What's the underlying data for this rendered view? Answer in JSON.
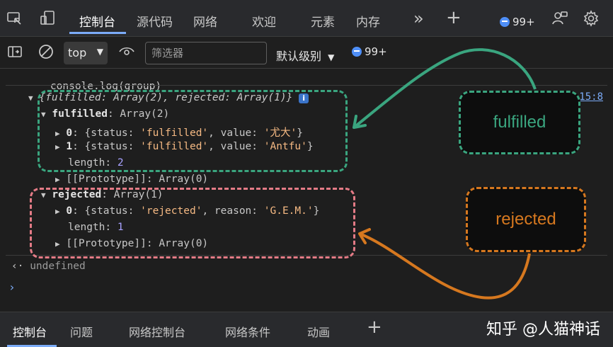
{
  "tabs": {
    "items": [
      {
        "label": "控制台"
      },
      {
        "label": "源代码"
      },
      {
        "label": "网络"
      },
      {
        "label": "欢迎"
      },
      {
        "label": "元素"
      },
      {
        "label": "内存"
      }
    ],
    "more_glyph": "»",
    "add_glyph": "+",
    "issues_badge": "99+"
  },
  "toolbar": {
    "context": "top",
    "filter_placeholder": "筛选器",
    "level": "默认级别",
    "issues_badge": "99+"
  },
  "console": {
    "command": "console.log(group)",
    "summary_fulfilled_key": "fulfilled",
    "summary_fulfilled_val": "Array(2)",
    "summary_rejected_key": "rejected",
    "summary_rejected_val": "Array(1)",
    "source_link": "15:8",
    "fulfilled_key": "fulfilled",
    "fulfilled_type": "Array(2)",
    "f0_index": "0",
    "f0_status": "'fulfilled'",
    "f0_value": "'尤大'",
    "f1_index": "1",
    "f1_status": "'fulfilled'",
    "f1_value": "'Antfu'",
    "length_key": "length",
    "f_length": "2",
    "prototype_label": "[[Prototype]]",
    "prototype_val": "Array(0)",
    "rejected_key": "rejected",
    "rejected_type": "Array(1)",
    "r0_index": "0",
    "r0_status": "'rejected'",
    "r0_reason": "'G.E.M.'",
    "r_length": "1",
    "result": "undefined"
  },
  "annotations": {
    "fulfilled_label": "fulfilled",
    "rejected_label": "rejected",
    "fulfilled_color": "#3aa57f",
    "rejected_color": "#d6781f",
    "rejected_box_color": "#e47b86"
  },
  "bottom_tabs": {
    "items": [
      {
        "label": "控制台"
      },
      {
        "label": "问题"
      },
      {
        "label": "网络控制台"
      },
      {
        "label": "网络条件"
      },
      {
        "label": "动画"
      }
    ],
    "add_glyph": "+"
  },
  "watermark": "知乎 @人猫神话"
}
